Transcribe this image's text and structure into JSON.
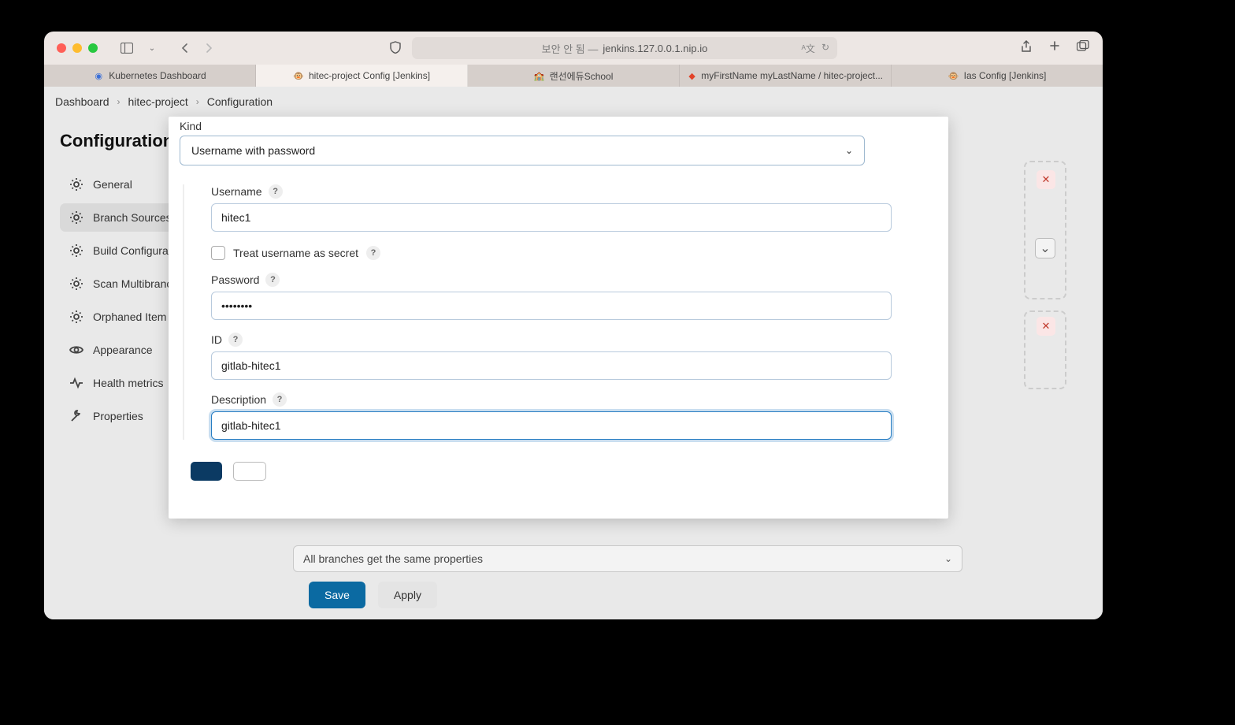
{
  "browser": {
    "url_status": "보안 안 됨 —",
    "url_host": "jenkins.127.0.0.1.nip.io",
    "tabs": [
      {
        "label": "Kubernetes Dashboard",
        "color": "#3a6fd8"
      },
      {
        "label": "hitec-project Config [Jenkins]",
        "color": "#888"
      },
      {
        "label": "랜선에듀School",
        "color": "#4a7"
      },
      {
        "label": "myFirstName myLastName / hitec-project...",
        "color": "#e24329"
      },
      {
        "label": "Ias Config [Jenkins]",
        "color": "#888"
      }
    ]
  },
  "breadcrumbs": [
    "Dashboard",
    "hitec-project",
    "Configuration"
  ],
  "page_title": "Configuration",
  "section_title": "Branch Sources",
  "sidebar_items": [
    {
      "label": "General"
    },
    {
      "label": "Branch Sources"
    },
    {
      "label": "Build Configuration"
    },
    {
      "label": "Scan Multibranch Pipeline Triggers"
    },
    {
      "label": "Orphaned Item Strategy"
    },
    {
      "label": "Appearance"
    },
    {
      "label": "Health metrics"
    },
    {
      "label": "Properties"
    }
  ],
  "bg_row_text": "All branches get the same properties",
  "footer": {
    "save": "Save",
    "apply": "Apply"
  },
  "modal": {
    "kind_label": "Kind",
    "kind_value": "Username with password",
    "fields": {
      "username_label": "Username",
      "username_value": "hitec1",
      "treat_secret_label": "Treat username as secret",
      "password_label": "Password",
      "password_value": "••••••••",
      "id_label": "ID",
      "id_value": "gitlab-hitec1",
      "description_label": "Description",
      "description_value": "gitlab-hitec1"
    }
  }
}
